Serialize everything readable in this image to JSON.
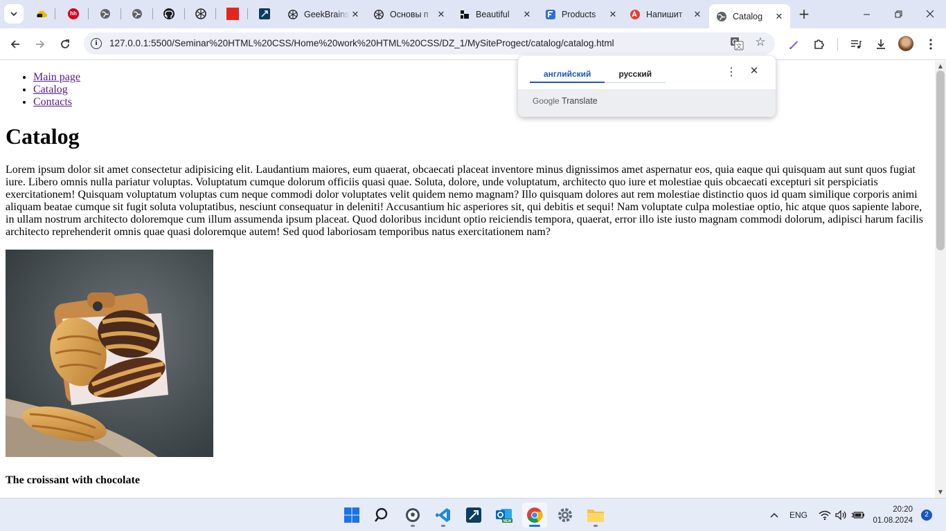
{
  "browser": {
    "tabs": [
      {
        "title": "GeekBrains"
      },
      {
        "title": "Основы п"
      },
      {
        "title": "Beautiful"
      },
      {
        "title": "Products"
      },
      {
        "title": "Напишит"
      },
      {
        "title": "Catalog",
        "active": true
      }
    ],
    "url": "127.0.0.1:5500/Seminar%20HTML%20CSS/Home%20work%20HTML%20CSS/DZ_1/MySiteProgect/catalog/catalog.html"
  },
  "translate_popup": {
    "source_lang": "английский",
    "target_lang": "русский",
    "brand_google": "Google",
    "brand_translate": "Translate"
  },
  "page": {
    "nav": [
      "Main page",
      "Catalog",
      "Contacts"
    ],
    "heading": "Catalog",
    "paragraph": "Lorem ipsum dolor sit amet consectetur adipisicing elit. Laudantium maiores, eum quaerat, obcaecati placeat inventore minus dignissimos amet aspernatur eos, quia eaque qui quisquam aut sunt quos fugiat iure. Libero omnis nulla pariatur voluptas. Voluptatum cumque dolorum officiis quasi quae. Soluta, dolore, unde voluptatum, architecto quo iure et molestiae quis obcaecati excepturi sit perspiciatis exercitationem! Quisquam voluptatum voluptas cum neque commodi dolor voluptates velit quidem nemo magnam? Illo quisquam dolores aut rem molestiae distinctio quos id quam similique corporis animi aliquam beatae cumque sit fugit soluta voluptatibus, nesciunt consequatur in deleniti! Accusantium hic asperiores sit, qui debitis et sequi! Nam voluptate culpa molestiae optio, hic atque quos sapiente labore, in ullam nostrum architecto doloremque cum illum assumenda ipsum placeat. Quod doloribus incidunt optio reiciendis tempora, quaerat, error illo iste iusto magnam commodi dolorum, adipisci harum facilis architecto reprehenderit omnis quae quasi doloremque autem! Sed quod laboriosam temporibus natus exercitationem nam?",
    "product_name": "The croissant with chocolate"
  },
  "taskbar": {
    "lang": "ENG",
    "time": "20:20",
    "date": "01.08.2024",
    "notifications": "2",
    "outlook_badge": "NEW"
  },
  "colors": {
    "accent": "#1a56c4",
    "visited_link": "#551a8b",
    "tabstrip": "#dfe5f5"
  }
}
